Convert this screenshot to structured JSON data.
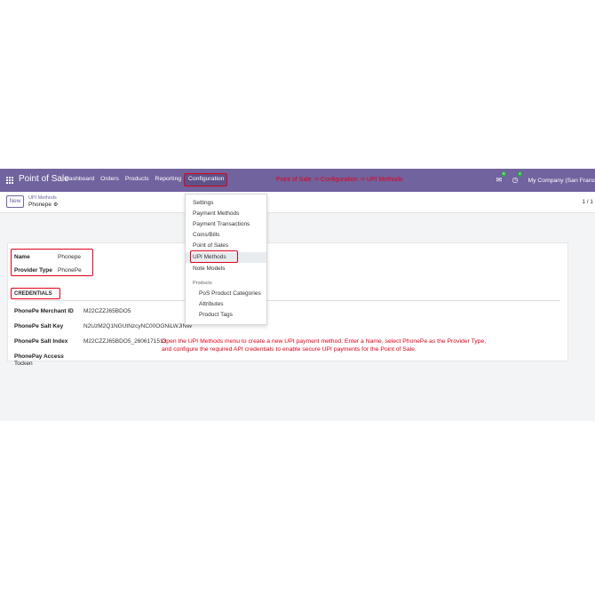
{
  "navbar": {
    "app_name": "Point of Sale",
    "menu": [
      "Dashboard",
      "Orders",
      "Products",
      "Reporting"
    ],
    "active_menu": "Configuration",
    "annotation": "Point of Sale -> Configuration -> UPI Methods",
    "messages_count": "6",
    "activity_count": "4",
    "company": "My Company (San Franc"
  },
  "control_panel": {
    "new_label": "New",
    "breadcrumb_parent": "UPI Methods",
    "breadcrumb_current": "Phonepe",
    "pager": "1 / 1"
  },
  "form": {
    "name_label": "Name",
    "name_value": "Phonepe",
    "provider_label": "Provider Type",
    "provider_value": "PhonePe",
    "credentials_title": "CREDENTIALS",
    "merchant_label": "PhonePe Merchant ID",
    "merchant_value": "M22CZZJ65BDO5",
    "salt_key_label": "PhonePe Salt Key",
    "salt_key_value": "N2UzM2Q1NGUtNzcyNC00OGNiLWJlNW",
    "salt_index_label": "PhonePe Salt Index",
    "salt_index_value": "M22CZZJ65BDO5_2606171513",
    "access_token_label_1": "PhonePay Access",
    "access_token_label_2": "Tocken",
    "help_line_1": "Open the UPI Methods menu to create a new UPI payment method. Enter a Name, select PhonePe as the Provider Type,",
    "help_line_2": "and configure the required API credentials to enable secure UPI payments for the Point of Sale."
  },
  "dropdown": {
    "items": [
      "Settings",
      "Payment Methods",
      "Payment Transactions",
      "Coins/Bills",
      "Point of Sales",
      "UPI Methods",
      "Note Models"
    ],
    "section_title": "Products",
    "product_items": [
      "PoS Product Categories",
      "Attributes",
      "Product Tags"
    ]
  },
  "colors": {
    "navbar": "#71639e",
    "highlight": "#e0001a",
    "badge": "#28a745"
  }
}
